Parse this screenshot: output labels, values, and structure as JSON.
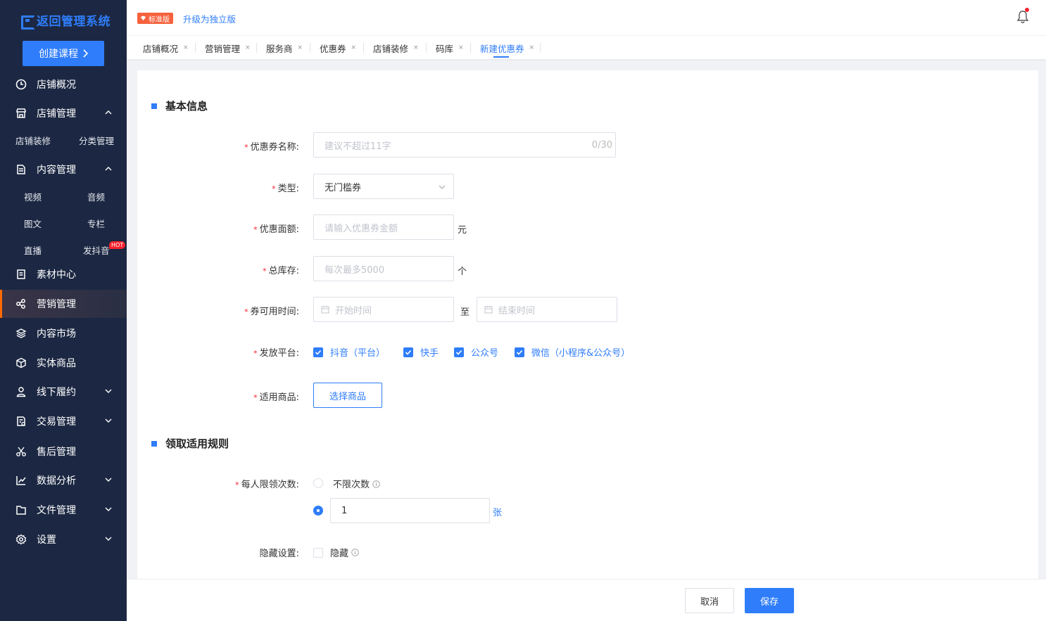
{
  "app": {
    "title": "返回管理系统",
    "create_button": "创建课程"
  },
  "sidebar": {
    "items": [
      {
        "label": "店铺概况",
        "icon": "clock-pie-icon"
      },
      {
        "label": "店铺管理",
        "icon": "store-icon",
        "expanded": true
      },
      {
        "label": "内容管理",
        "icon": "content-icon",
        "expanded": true
      },
      {
        "label": "素材中心",
        "icon": "material-icon"
      },
      {
        "label": "营销管理",
        "icon": "marketing-icon",
        "active": true
      },
      {
        "label": "内容市场",
        "icon": "layers-icon"
      },
      {
        "label": "实体商品",
        "icon": "box-icon"
      },
      {
        "label": "线下履约",
        "icon": "user-icon"
      },
      {
        "label": "交易管理",
        "icon": "trade-icon"
      },
      {
        "label": "售后管理",
        "icon": "scissors-icon"
      },
      {
        "label": "数据分析",
        "icon": "chart-icon"
      },
      {
        "label": "文件管理",
        "icon": "folder-icon"
      },
      {
        "label": "设置",
        "icon": "gear-icon"
      }
    ],
    "store_sub": [
      "店铺装修",
      "分类管理"
    ],
    "content_sub": [
      "视频",
      "音频",
      "图文",
      "专栏",
      "直播",
      "发抖音"
    ],
    "hot_badge": "HOT"
  },
  "topbar": {
    "edition": "标准版",
    "upgrade": "升级为独立版"
  },
  "tabs": [
    "店铺概况",
    "营销管理",
    "服务商",
    "优惠券",
    "店铺装修",
    "码库",
    "新建优惠券"
  ],
  "tab_close": "×",
  "form": {
    "basic_section": "基本信息",
    "name_label": "优惠券名称:",
    "name_placeholder": "建议不超过11字",
    "name_count": "0/30",
    "type_label": "类型:",
    "type_value": "无门槛券",
    "amount_label": "优惠面额:",
    "amount_placeholder": "请输入优惠券金额",
    "amount_unit": "元",
    "stock_label": "总库存:",
    "stock_placeholder": "每次最多5000",
    "stock_unit": "个",
    "time_label": "券可用时间:",
    "start_placeholder": "开始时间",
    "time_sep": "至",
    "end_placeholder": "结束时间",
    "platform_label": "发放平台:",
    "platforms": [
      "抖音（平台）",
      "快手",
      "公众号",
      "微信（小程序&公众号）"
    ],
    "goods_label": "适用商品:",
    "goods_button": "选择商品",
    "rules_section": "领取适用规则",
    "limit_label": "每人限领次数:",
    "unlimited": "不限次数",
    "limit_value": "1",
    "limit_unit": "张",
    "hide_label": "隐藏设置:",
    "hide_option": "隐藏",
    "required_mark": "*"
  },
  "footer": {
    "cancel": "取消",
    "save": "保存"
  },
  "colors": {
    "sidebar": "#1c2843",
    "accent": "#2f7dfa",
    "active_border": "#ff6a00",
    "danger": "#f5222d"
  }
}
